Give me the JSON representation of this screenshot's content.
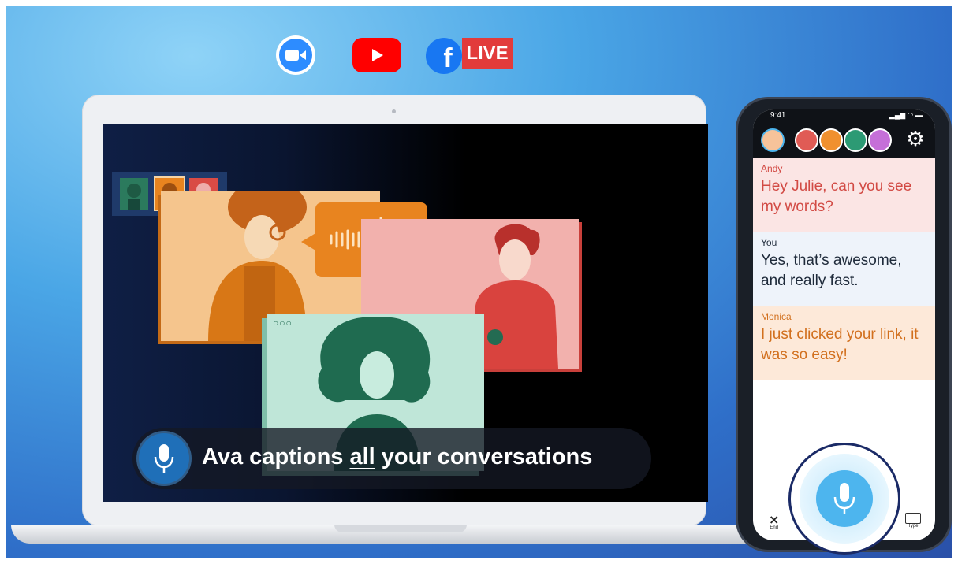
{
  "logos": {
    "zoom": "zoom-camera-icon",
    "youtube": "youtube-play-icon",
    "facebook_letter": "f",
    "live_label": "LIVE"
  },
  "caption": {
    "pre": "Ava captions ",
    "emph": "all",
    "post": " your conversations"
  },
  "colors": {
    "accent_blue": "#4db5ee",
    "andy": "#d24a44",
    "you": "#1e2a3a",
    "monica": "#d2701e"
  },
  "phone": {
    "status_time": "9:41",
    "messages": [
      {
        "name": "Andy",
        "text": "Hey Julie, can you see my words?"
      },
      {
        "name": "You",
        "text": "Yes, that’s awesome, and really fast."
      },
      {
        "name": "Monica",
        "text": "I just clicked your link, it was so easy!"
      }
    ],
    "bottom_left_label": "End",
    "bottom_right_label": "Type"
  }
}
